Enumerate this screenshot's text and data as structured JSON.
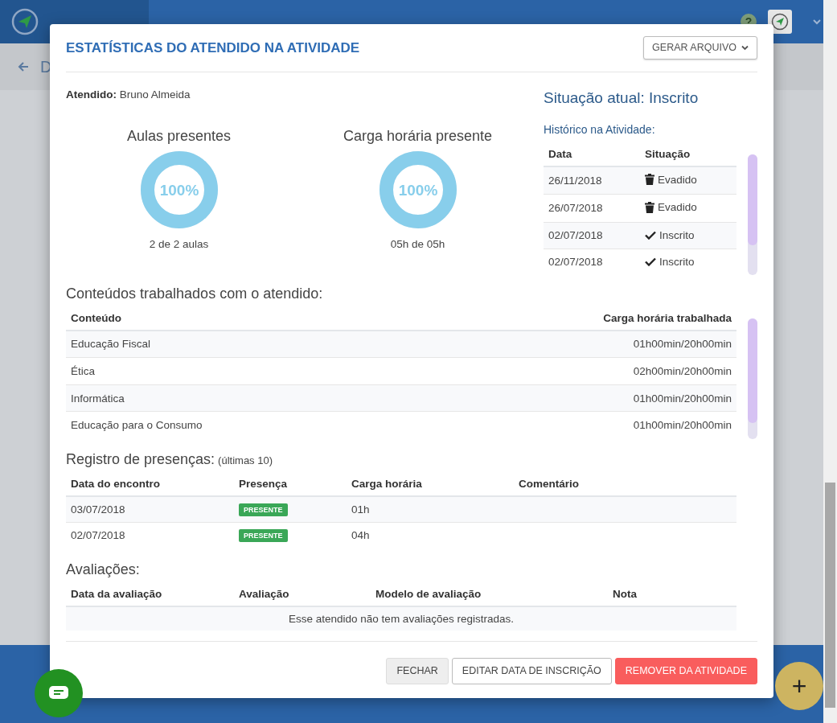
{
  "app": {
    "help": "?"
  },
  "page": {
    "back_label": "D"
  },
  "modal": {
    "title": "ESTATÍSTICAS DO ATENDIDO NA ATIVIDADE",
    "export_button": "GERAR ARQUIVO",
    "attendee_label": "Atendido:",
    "attendee_name": "Bruno Almeida",
    "gauges": [
      {
        "title": "Aulas presentes",
        "value": "100%",
        "level": 1,
        "caption": "2 de 2 aulas"
      },
      {
        "title": "Carga horária presente",
        "value": "100%",
        "level": 1,
        "caption": "05h de 05h"
      }
    ],
    "current_status": "Situação atual: Inscrito",
    "history_title": "Histórico na Atividade:",
    "history": {
      "columns": [
        "Data",
        "Situação"
      ],
      "rows": [
        {
          "date": "26/11/2018",
          "status": "Evadido",
          "kind": "evaded"
        },
        {
          "date": "26/07/2018",
          "status": "Evadido",
          "kind": "evaded"
        },
        {
          "date": "02/07/2018",
          "status": "Inscrito",
          "kind": "enrolled"
        },
        {
          "date": "02/07/2018",
          "status": "Inscrito",
          "kind": "enrolled"
        }
      ]
    },
    "contents": {
      "title": "Conteúdos trabalhados com o atendido:",
      "columns": [
        "Conteúdo",
        "Carga horária trabalhada"
      ],
      "rows": [
        {
          "name": "Educação Fiscal",
          "hours": "01h00min/20h00min"
        },
        {
          "name": "Ética",
          "hours": "02h00min/20h00min"
        },
        {
          "name": "Informática",
          "hours": "01h00min/20h00min"
        },
        {
          "name": "Educação para o Consumo",
          "hours": "01h00min/20h00min"
        }
      ]
    },
    "attendance": {
      "title": "Registro de presenças:",
      "note": "(últimas 10)",
      "columns": [
        "Data do encontro",
        "Presença",
        "Carga horária",
        "Comentário"
      ],
      "rows": [
        {
          "date": "03/07/2018",
          "presence": "PRESENTE",
          "hours": "01h"
        },
        {
          "date": "02/07/2018",
          "presence": "PRESENTE",
          "hours": "04h"
        }
      ]
    },
    "evaluations": {
      "title": "Avaliações:",
      "columns": [
        "Data da avaliação",
        "Avaliação",
        "Modelo de avaliação",
        "Nota"
      ],
      "empty_message": "Esse atendido não tem avaliações registradas."
    },
    "buttons": [
      {
        "label": "FECHAR",
        "kind": "secondary"
      },
      {
        "label": "EDITAR DATA DE INSCRIÇÃO",
        "kind": "outline"
      },
      {
        "label": "REMOVER DA ATIVIDADE",
        "kind": "danger"
      }
    ]
  },
  "fab": {
    "label": "+"
  }
}
